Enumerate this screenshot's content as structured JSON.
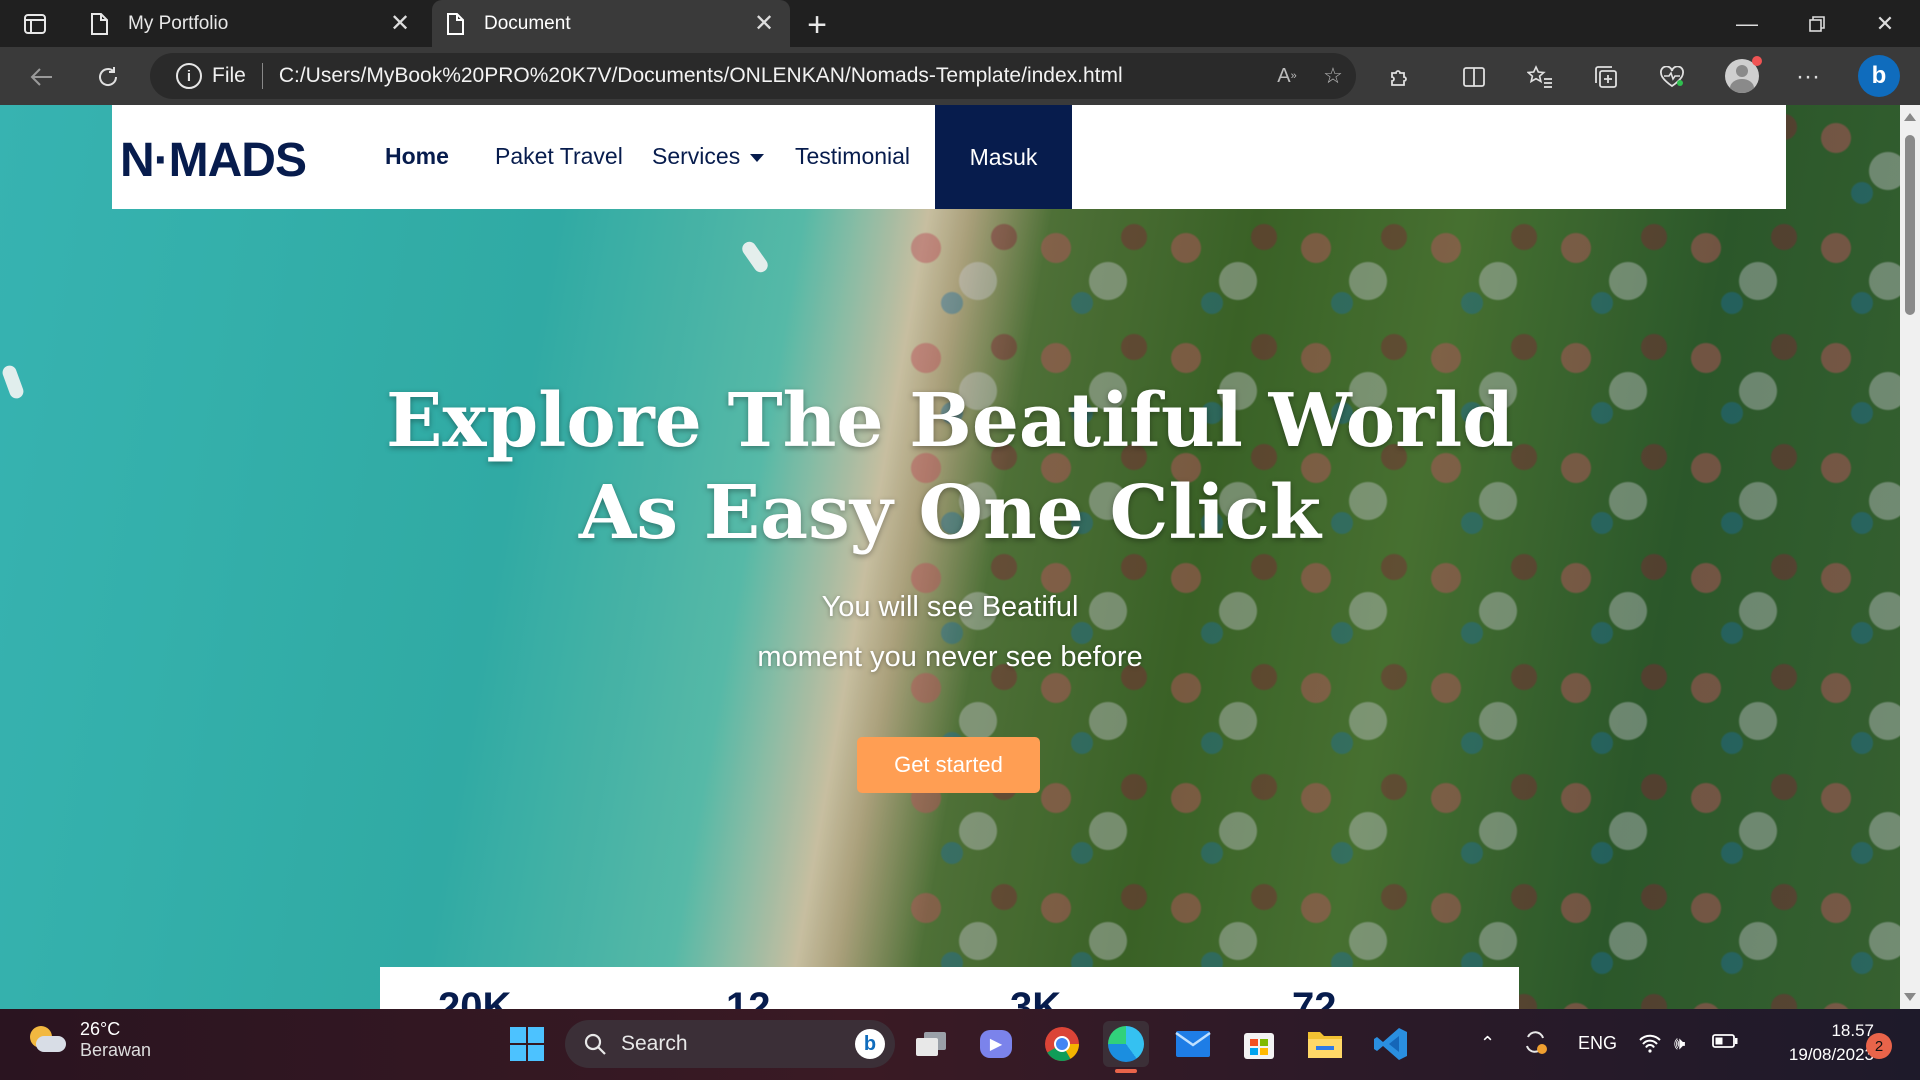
{
  "browser": {
    "tabs": [
      {
        "title": "My Portfolio",
        "active": false
      },
      {
        "title": "Document",
        "active": true
      }
    ],
    "address": {
      "scheme_label": "File",
      "url": "C:/Users/MyBook%20PRO%20K7V/Documents/ONLENKAN/Nomads-Template/index.html"
    }
  },
  "page": {
    "logo": "N·MADS",
    "nav": {
      "home": "Home",
      "paket_travel": "Paket Travel",
      "services": "Services",
      "testimonial": "Testimonial",
      "login": "Masuk"
    },
    "hero": {
      "title_line1": "Explore The Beatiful World",
      "title_line2": "As Easy One Click",
      "subtitle_line1": "You will see Beatiful",
      "subtitle_line2": "moment you never see before",
      "cta": "Get started"
    },
    "stats_partial": [
      "20K",
      "12",
      "3K",
      "72"
    ]
  },
  "taskbar": {
    "weather_temp": "26°C",
    "weather_desc": "Berawan",
    "search_placeholder": "Search",
    "language": "ENG",
    "time": "18.57",
    "date": "19/08/2023",
    "notifications": "2"
  },
  "colors": {
    "brand_navy": "#071c4d",
    "cta_orange": "#ff9e53"
  }
}
